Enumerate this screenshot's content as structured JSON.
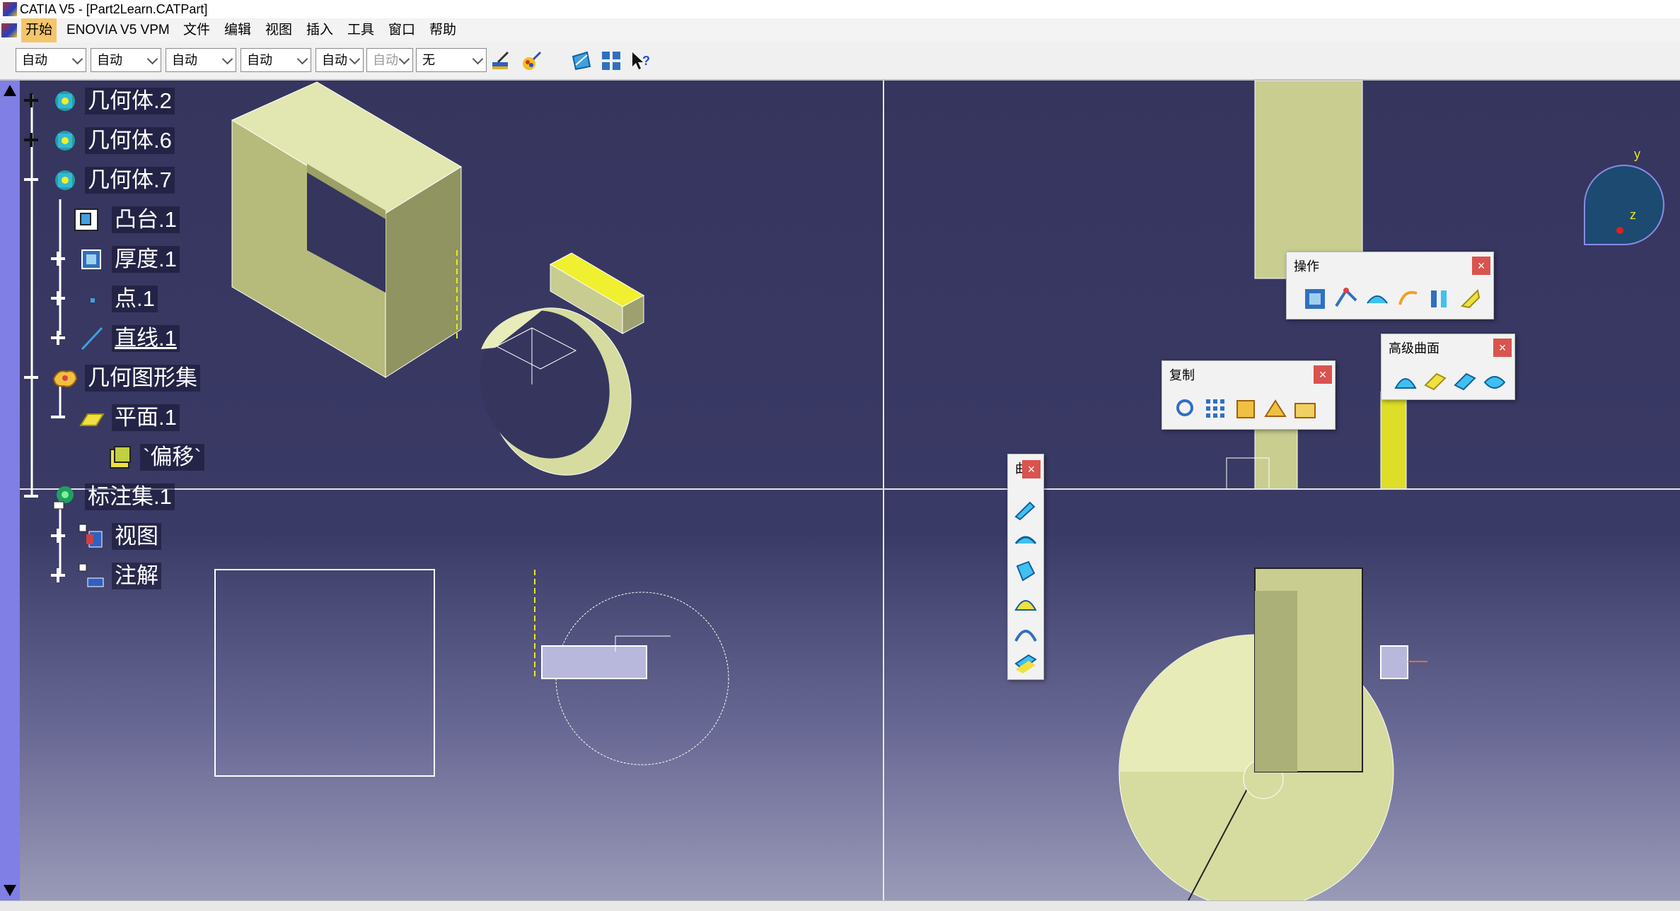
{
  "window": {
    "title": "CATIA V5 - [Part2Learn.CATPart]"
  },
  "menu": [
    {
      "label": "开始"
    },
    {
      "label": "ENOVIA V5 VPM"
    },
    {
      "label": "文件"
    },
    {
      "label": "编辑"
    },
    {
      "label": "视图"
    },
    {
      "label": "插入"
    },
    {
      "label": "工具"
    },
    {
      "label": "窗口"
    },
    {
      "label": "帮助"
    }
  ],
  "toolbar": {
    "combos": [
      {
        "value": "自动"
      },
      {
        "value": "自动"
      },
      {
        "value": "自动"
      },
      {
        "value": "自动"
      },
      {
        "value": "自动"
      },
      {
        "value": "自动"
      },
      {
        "value": "无"
      }
    ],
    "icons": [
      "paint-brush-icon",
      "color-palette-icon",
      "view-normal-icon",
      "grid-mode-icon",
      "whats-this-help-icon"
    ]
  },
  "tree": {
    "nodes": [
      {
        "label": "几何体.2",
        "icon": "body-icon"
      },
      {
        "label": "几何体.6",
        "icon": "body-icon"
      },
      {
        "label": "几何体.7",
        "icon": "body-icon"
      },
      {
        "label": "凸台.1",
        "icon": "pad-icon"
      },
      {
        "label": "厚度.1",
        "icon": "thickness-icon"
      },
      {
        "label": "点.1",
        "icon": "point-icon"
      },
      {
        "label": "直线.1",
        "icon": "line-icon"
      },
      {
        "label": "几何图形集",
        "icon": "geometrical-set-icon"
      },
      {
        "label": "平面.1",
        "icon": "plane-icon"
      },
      {
        "label": "`偏移`",
        "icon": "offset-icon"
      },
      {
        "label": "标注集.1",
        "icon": "annotation-set-icon"
      },
      {
        "label": "视图",
        "icon": "views-icon"
      },
      {
        "label": "注解",
        "icon": "annotations-icon"
      }
    ]
  },
  "compass": {
    "y_label": "y",
    "z_label": "z"
  },
  "panels": {
    "operations": {
      "title": "操作",
      "close": "×"
    },
    "advanced_surfaces": {
      "title": "高级曲面",
      "close": "×"
    },
    "replication": {
      "title": "复制",
      "close": "×"
    },
    "vertical": {
      "title": "曲",
      "close": "×"
    }
  },
  "colors": {
    "viewport_top": "#35355e",
    "viewport_bottom": "#9a9ab8",
    "solid_face": "#d6dca0",
    "solid_dark": "#8f9460",
    "highlight_yellow": "#e8e820",
    "scroll": "#7f7fe6",
    "menu_active": "#f5c56b",
    "close_red": "#d9534f"
  }
}
